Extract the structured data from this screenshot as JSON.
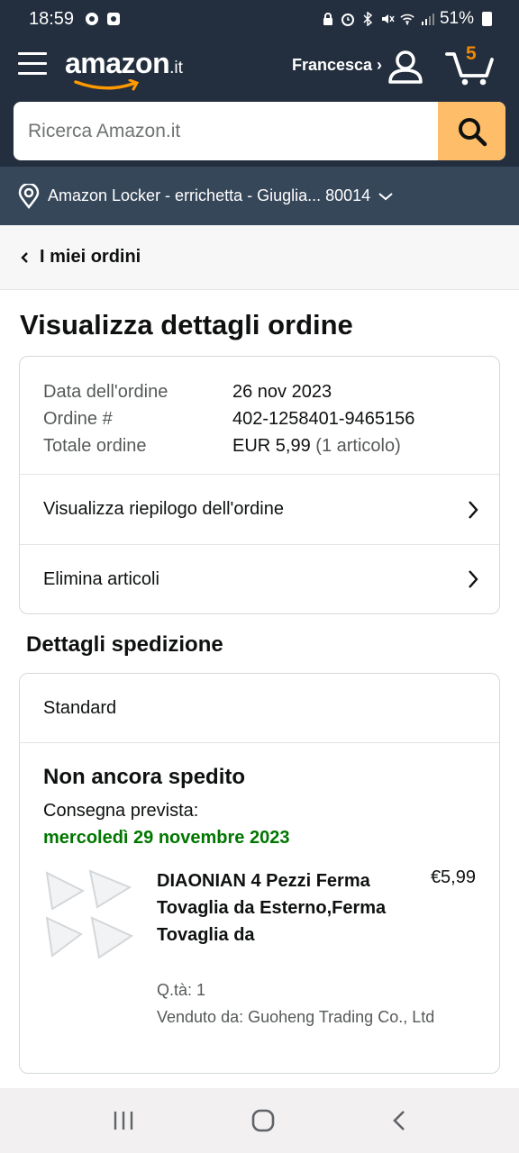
{
  "status_bar": {
    "time": "18:59",
    "battery": "51%"
  },
  "header": {
    "logo_text": "amazon",
    "logo_tld": ".it",
    "account_label": "Francesca ›",
    "cart_count": "5",
    "search_placeholder": "Ricerca Amazon.it"
  },
  "location": {
    "text": "Amazon Locker - errichetta - Giuglia... 80014"
  },
  "back_nav": {
    "label": "I miei ordini"
  },
  "page_title": "Visualizza dettagli ordine",
  "order_info": {
    "date_label": "Data dell'ordine",
    "date_value": "26 nov 2023",
    "number_label": "Ordine #",
    "number_value": "402-1258401-9465156",
    "total_label": "Totale ordine",
    "total_value": "EUR 5,99",
    "total_items": "(1 articolo)"
  },
  "actions": {
    "summary": "Visualizza riepilogo dell'ordine",
    "delete": "Elimina articoli"
  },
  "shipping": {
    "section_title": "Dettagli spedizione",
    "method": "Standard",
    "status": "Non ancora spedito",
    "delivery_label": "Consegna prevista:",
    "delivery_date": "mercoledì 29 novembre 2023",
    "item": {
      "title": "DIAONIAN 4 Pezzi Ferma Tovaglia da Esterno,Ferma Tovaglia da",
      "price": "€5,99",
      "qty": "Q.tà: 1",
      "seller": "Venduto da: Guoheng Trading Co., Ltd"
    }
  },
  "colors": {
    "header_bg": "#232f3e",
    "location_bg": "#37475a",
    "search_button": "#febd69",
    "cart_count": "#f08804",
    "delivery_green": "#007600"
  }
}
